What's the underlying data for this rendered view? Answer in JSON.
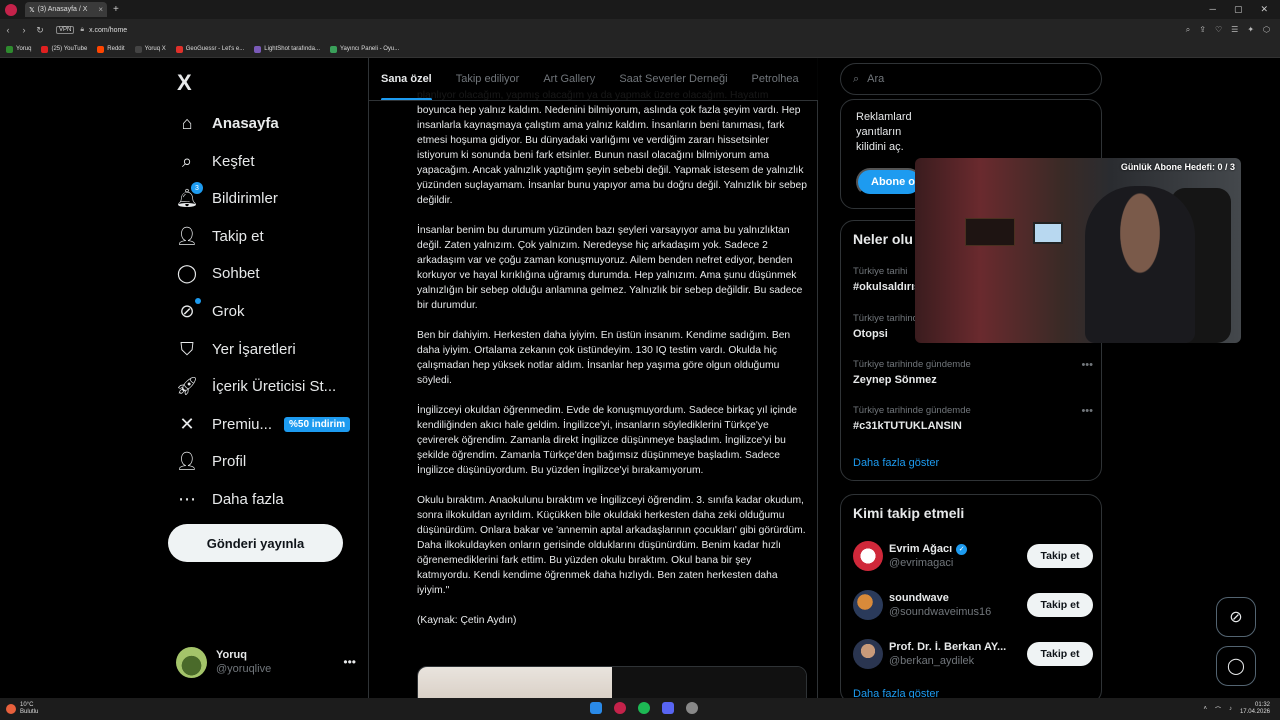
{
  "browser": {
    "tab_title": "(3) Anasayfa / X",
    "url": "x.com/home",
    "vpn_label": "VPN",
    "bookmarks": [
      "Yoruq",
      "(25) YouTube",
      "Reddit",
      "Yoruq X",
      "GeoGuessr - Let's e...",
      "LightShot tarafında...",
      "Yayıncı Paneli - Oyu..."
    ],
    "bookmark_colors": [
      "#2e8b2e",
      "#e02020",
      "#ff4500",
      "#444444",
      "#e0302a",
      "#7a5ab8",
      "#3aa05a"
    ]
  },
  "sidebar": {
    "logo": "X",
    "items": [
      {
        "label": "Anasayfa",
        "icon": "home-icon"
      },
      {
        "label": "Keşfet",
        "icon": "search-icon"
      },
      {
        "label": "Bildirimler",
        "icon": "bell-icon",
        "badge": "3"
      },
      {
        "label": "Takip et",
        "icon": "add-user-icon"
      },
      {
        "label": "Sohbet",
        "icon": "chat-icon"
      },
      {
        "label": "Grok",
        "icon": "grok-icon"
      },
      {
        "label": "Yer İşaretleri",
        "icon": "bookmark-icon"
      },
      {
        "label": "İçerik Üreticisi St...",
        "icon": "rocket-icon"
      },
      {
        "label": "Premiu...",
        "icon": "x-logo-icon",
        "promo": "%50 indirim"
      },
      {
        "label": "Profil",
        "icon": "profile-icon"
      },
      {
        "label": "Daha fazla",
        "icon": "more-icon"
      }
    ],
    "post_button": "Gönderi yayınla",
    "account": {
      "name": "Yoruq",
      "handle": "@yoruqlive"
    }
  },
  "feed": {
    "tabs": [
      "Sana özel",
      "Takip ediliyor",
      "Art Gallery",
      "Saat Severler Derneği",
      "Petrolhea"
    ],
    "paragraphs": [
      "planlıyor olacağım, yapmış olacağım ya da yapmak üzere olacağım. Hayatım boyunca hep yalnız kaldım. Nedenini bilmiyorum, aslında çok fazla şeyim vardı. Hep insanlarla kaynaşmaya çalıştım ama yalnız kaldım. İnsanların beni tanıması, fark etmesi hoşuma gidiyor. Bu dünyadaki varlığımı ve verdiğim zararı hissetsinler istiyorum ki sonunda beni fark etsinler. Bunun nasıl olacağını bilmiyorum ama yapacağım. Ancak yalnızlık yaptığım şeyin sebebi değil. Yapmak istesem de yalnızlık yüzünden suçlayamam. İnsanlar bunu yapıyor ama bu doğru değil. Yalnızlık bir sebep değildir.",
      "İnsanlar benim bu durumum yüzünden bazı şeyleri varsayıyor ama bu yalnızlıktan değil. Zaten yalnızım. Çok yalnızım. Neredeyse hiç arkadaşım yok. Sadece 2 arkadaşım var ve çoğu zaman konuşmuyoruz. Ailem benden nefret ediyor, benden korkuyor ve hayal kırıklığına uğramış durumda. Hep yalnızım. Ama şunu düşünmek yalnızlığın bir sebep olduğu anlamına gelmez. Yalnızlık bir sebep değildir. Bu sadece bir durumdur.",
      "Ben bir dahiyim. Herkesten daha iyiyim. En üstün insanım. Kendime sadığım. Ben daha iyiyim. Ortalama zekanın çok üstündeyim. 130 IQ testim vardı. Okulda hiç çalışmadan hep yüksek notlar aldım. İnsanlar hep yaşıma göre olgun olduğumu söyledi.",
      "İngilizceyi okuldan öğrenmedim. Evde de konuşmuyordum. Sadece birkaç yıl içinde kendiliğinden akıcı hale geldim. İngilizce'yi, insanların söylediklerini Türkçe'ye çevirerek öğrendim. Zamanla direkt İngilizce düşünmeye başladım. İngilizce'yi bu şekilde öğrendim. Zamanla Türkçe'den bağımsız düşünmeye başladım. Sadece İngilizce düşünüyordum. Bu yüzden İngilizce'yi bırakamıyorum.",
      "Okulu bıraktım. Anaokulunu bıraktım ve İngilizceyi öğrendim. 3. sınıfa kadar okudum, sonra ilkokuldan ayrıldım. Küçükken bile okuldaki herkesten daha zeki olduğumu düşünürdüm. Onlara bakar ve 'annemin aptal arkadaşlarının çocukları' gibi görürdüm. Daha ilkokuldayken onların gerisinde olduklarını düşünürdüm. Benim kadar hızlı öğrenemediklerini fark ettim. Bu yüzden okulu bıraktım. Okul bana bir şey katmıyordu. Kendi kendime öğrenmek daha hızlıydı. Ben zaten herkesten daha iyiyim.\"",
      "(Kaynak: Çetin Aydın)"
    ]
  },
  "right": {
    "search_placeholder": "Ara",
    "premium": {
      "text": "Reklamlard yanıtların kilidini aç.",
      "button": "Abone ol"
    },
    "trends_title": "Neler olu",
    "trends": [
      {
        "context": "Türkiye tarihi",
        "name": "#okulsaldırısı"
      },
      {
        "context": "Türkiye tarihinde gündemde",
        "name": "Otopsi"
      },
      {
        "context": "Türkiye tarihinde gündemde",
        "name": "Zeynep Sönmez"
      },
      {
        "context": "Türkiye tarihinde gündemde",
        "name": "#c31kTUTUKLANSIN"
      }
    ],
    "show_more": "Daha fazla göster",
    "follow_title": "Kimi takip etmeli",
    "follow": [
      {
        "name": "Evrim Ağacı",
        "handle": "@evrimagaci",
        "button": "Takip et",
        "verified": true
      },
      {
        "name": "soundwave",
        "handle": "@soundwaveimus16",
        "button": "Takip et",
        "verified": false
      },
      {
        "name": "Prof. Dr. İ. Berkan AY...",
        "handle": "@berkan_aydilek",
        "button": "Takip et",
        "verified": false
      }
    ],
    "follow_show_more": "Daha fazla göster"
  },
  "overlay": {
    "label": "Günlük Abone Hedefi: 0 / 3"
  },
  "taskbar": {
    "temp": "10°C",
    "weather": "Bulutlu",
    "time": "01:32",
    "date": "17.04.2026"
  }
}
